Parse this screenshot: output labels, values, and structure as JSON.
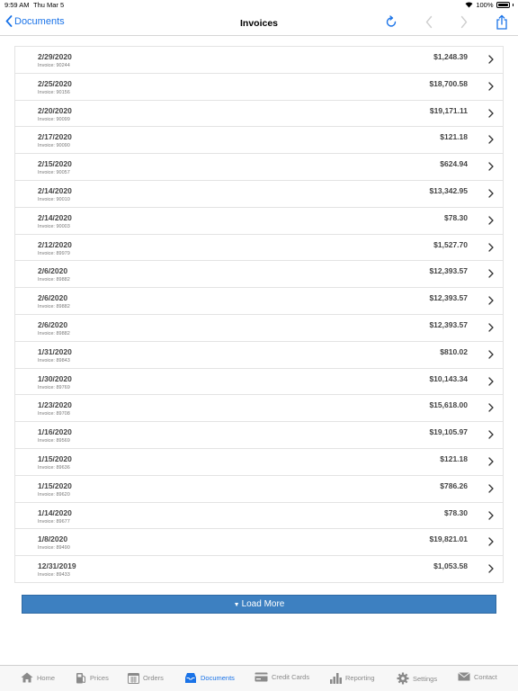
{
  "status": {
    "time": "9:59 AM",
    "date": "Thu Mar 5",
    "battery": "100%"
  },
  "nav": {
    "back_label": "Documents",
    "title": "Invoices"
  },
  "invoices": [
    {
      "date": "2/29/2020",
      "invoice": "Invoice: 90244",
      "amount": "$1,248.39"
    },
    {
      "date": "2/25/2020",
      "invoice": "Invoice: 90156",
      "amount": "$18,700.58"
    },
    {
      "date": "2/20/2020",
      "invoice": "Invoice: 90099",
      "amount": "$19,171.11"
    },
    {
      "date": "2/17/2020",
      "invoice": "Invoice: 90090",
      "amount": "$121.18"
    },
    {
      "date": "2/15/2020",
      "invoice": "Invoice: 90057",
      "amount": "$624.94"
    },
    {
      "date": "2/14/2020",
      "invoice": "Invoice: 90010",
      "amount": "$13,342.95"
    },
    {
      "date": "2/14/2020",
      "invoice": "Invoice: 90003",
      "amount": "$78.30"
    },
    {
      "date": "2/12/2020",
      "invoice": "Invoice: 89979",
      "amount": "$1,527.70"
    },
    {
      "date": "2/6/2020",
      "invoice": "Invoice: 89882",
      "amount": "$12,393.57"
    },
    {
      "date": "2/6/2020",
      "invoice": "Invoice: 89882",
      "amount": "$12,393.57"
    },
    {
      "date": "2/6/2020",
      "invoice": "Invoice: 89882",
      "amount": "$12,393.57"
    },
    {
      "date": "1/31/2020",
      "invoice": "Invoice: 89843",
      "amount": "$810.02"
    },
    {
      "date": "1/30/2020",
      "invoice": "Invoice: 89769",
      "amount": "$10,143.34"
    },
    {
      "date": "1/23/2020",
      "invoice": "Invoice: 89708",
      "amount": "$15,618.00"
    },
    {
      "date": "1/16/2020",
      "invoice": "Invoice: 89569",
      "amount": "$19,105.97"
    },
    {
      "date": "1/15/2020",
      "invoice": "Invoice: 89636",
      "amount": "$121.18"
    },
    {
      "date": "1/15/2020",
      "invoice": "Invoice: 89620",
      "amount": "$786.26"
    },
    {
      "date": "1/14/2020",
      "invoice": "Invoice: 89677",
      "amount": "$78.30"
    },
    {
      "date": "1/8/2020",
      "invoice": "Invoice: 89490",
      "amount": "$19,821.01"
    },
    {
      "date": "12/31/2019",
      "invoice": "Invoice: 89433",
      "amount": "$1,053.58"
    }
  ],
  "load_more_label": "Load More",
  "tabs": [
    {
      "label": "Home",
      "icon": "home-icon"
    },
    {
      "label": "Prices",
      "icon": "fuel-pump-icon"
    },
    {
      "label": "Orders",
      "icon": "calendar-icon"
    },
    {
      "label": "Documents",
      "icon": "inbox-icon"
    },
    {
      "label": "Credit Cards",
      "icon": "credit-card-icon"
    },
    {
      "label": "Reporting",
      "icon": "bar-chart-icon"
    },
    {
      "label": "Settings",
      "icon": "gear-icon"
    },
    {
      "label": "Contact",
      "icon": "envelope-icon"
    }
  ],
  "colors": {
    "accent": "#1a73e8",
    "button": "#3d80c1",
    "inactive": "#8a8a8a"
  }
}
